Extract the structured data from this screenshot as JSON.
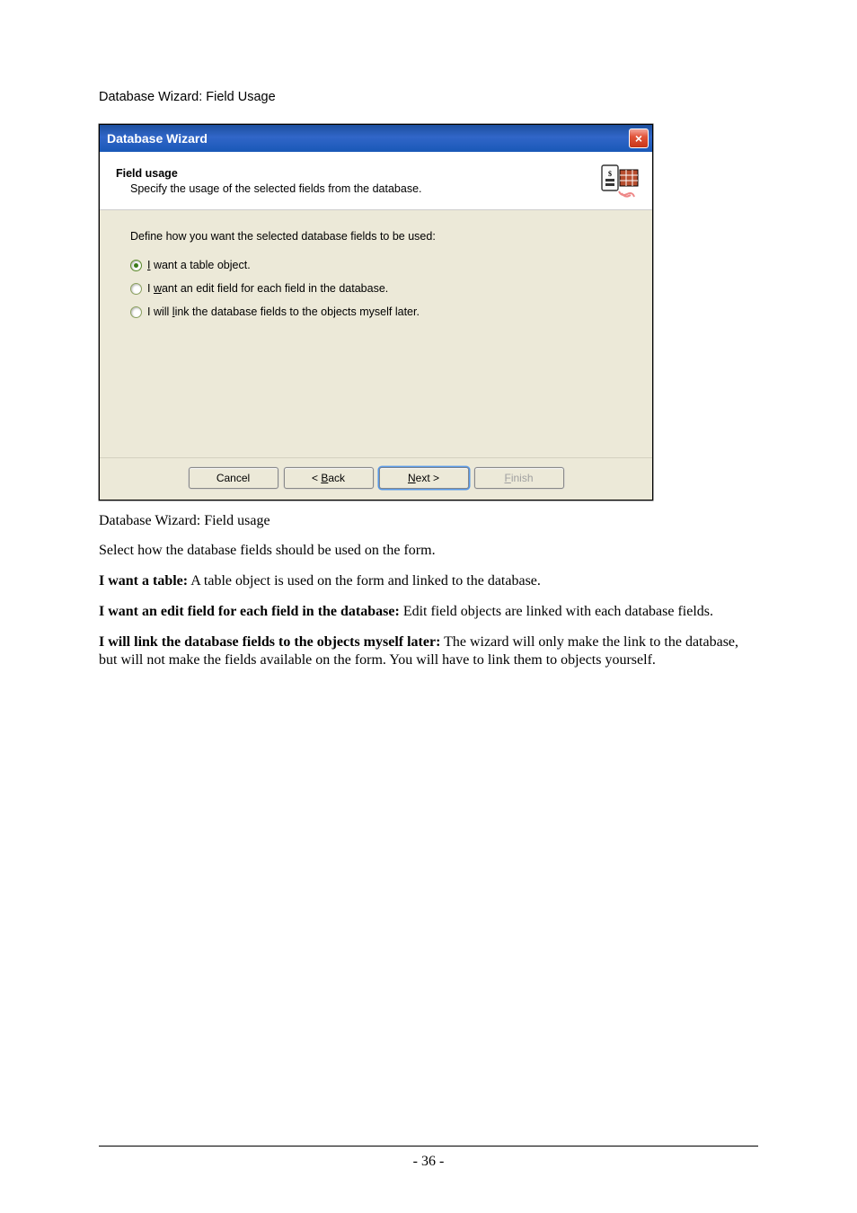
{
  "section_heading": "Database Wizard: Field Usage",
  "dialog": {
    "title": "Database Wizard",
    "header": {
      "title": "Field usage",
      "subtitle": "Specify the usage of the selected fields from the database."
    },
    "body": {
      "instruction": "Define how you want the selected database fields to be used:",
      "options": [
        {
          "selected": true,
          "pre": "",
          "u": "I",
          "post": " want a table object."
        },
        {
          "selected": false,
          "pre": "I ",
          "u": "w",
          "post": "ant an edit field for each field in the database."
        },
        {
          "selected": false,
          "pre": "I will ",
          "u": "l",
          "post": "ink the database fields to the objects myself later."
        }
      ]
    },
    "footer": {
      "cancel": "Cancel",
      "back_pre": "< ",
      "back_u": "B",
      "back_post": "ack",
      "next_u": "N",
      "next_post": "ext >",
      "finish_u": "F",
      "finish_post": "inish"
    }
  },
  "caption": "Database Wizard: Field usage",
  "paragraphs": {
    "intro": "Select how the database fields should be used on the form.",
    "p1_bold": "I want a table:",
    "p1_text": " A table object is used on the form and linked to the database.",
    "p2_bold": "I want an edit field for each field in the database:",
    "p2_text": " Edit field objects are linked with each database fields.",
    "p3_bold": "I will link the database fields to the objects myself later:",
    "p3_text": " The wizard will only make the link to the database, but will not make the fields available on the form. You will have to link them to objects yourself."
  },
  "page_number": "- 36 -"
}
